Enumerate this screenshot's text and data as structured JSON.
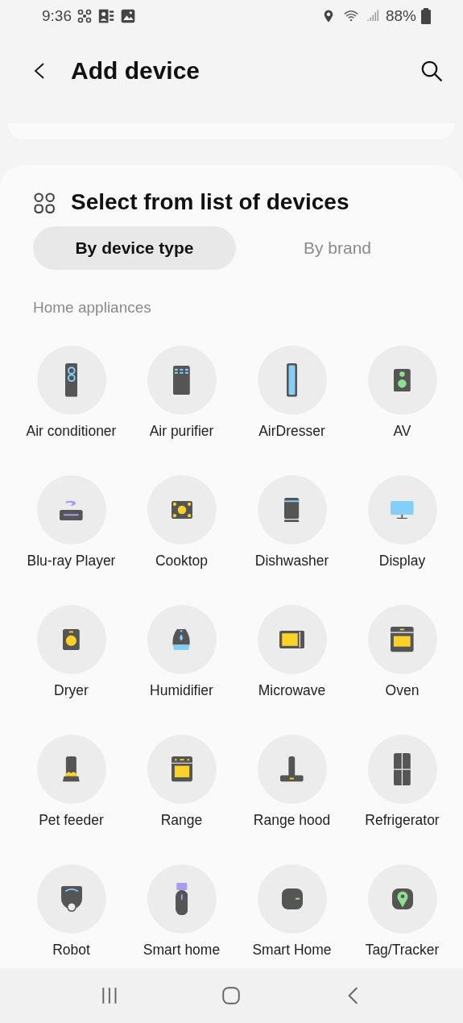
{
  "status_bar": {
    "time": "9:36",
    "battery": "88%"
  },
  "header": {
    "title": "Add device"
  },
  "section": {
    "title": "Select from list of devices",
    "tabs": [
      {
        "label": "By device type",
        "selected": true
      },
      {
        "label": "By brand",
        "selected": false
      }
    ],
    "category": "Home appliances",
    "devices": [
      {
        "label": "Air conditioner",
        "kind": "aircon"
      },
      {
        "label": "Air purifier",
        "kind": "purifier"
      },
      {
        "label": "AirDresser",
        "kind": "airdresser"
      },
      {
        "label": "AV",
        "kind": "speaker"
      },
      {
        "label": "Blu-ray Player",
        "kind": "bluray"
      },
      {
        "label": "Cooktop",
        "kind": "cooktop"
      },
      {
        "label": "Dishwasher",
        "kind": "dishwasher"
      },
      {
        "label": "Display",
        "kind": "display"
      },
      {
        "label": "Dryer",
        "kind": "dryer"
      },
      {
        "label": "Humidifier",
        "kind": "humidifier"
      },
      {
        "label": "Microwave",
        "kind": "microwave"
      },
      {
        "label": "Oven",
        "kind": "oven"
      },
      {
        "label": "Pet feeder",
        "kind": "petfeeder"
      },
      {
        "label": "Range",
        "kind": "range"
      },
      {
        "label": "Range hood",
        "kind": "hood"
      },
      {
        "label": "Refrigerator",
        "kind": "fridge"
      },
      {
        "label": "Robot",
        "kind": "robot"
      },
      {
        "label": "Smart home",
        "kind": "usb"
      },
      {
        "label": "Smart Home",
        "kind": "hub"
      },
      {
        "label": "Tag/Tracker",
        "kind": "tag"
      }
    ]
  }
}
